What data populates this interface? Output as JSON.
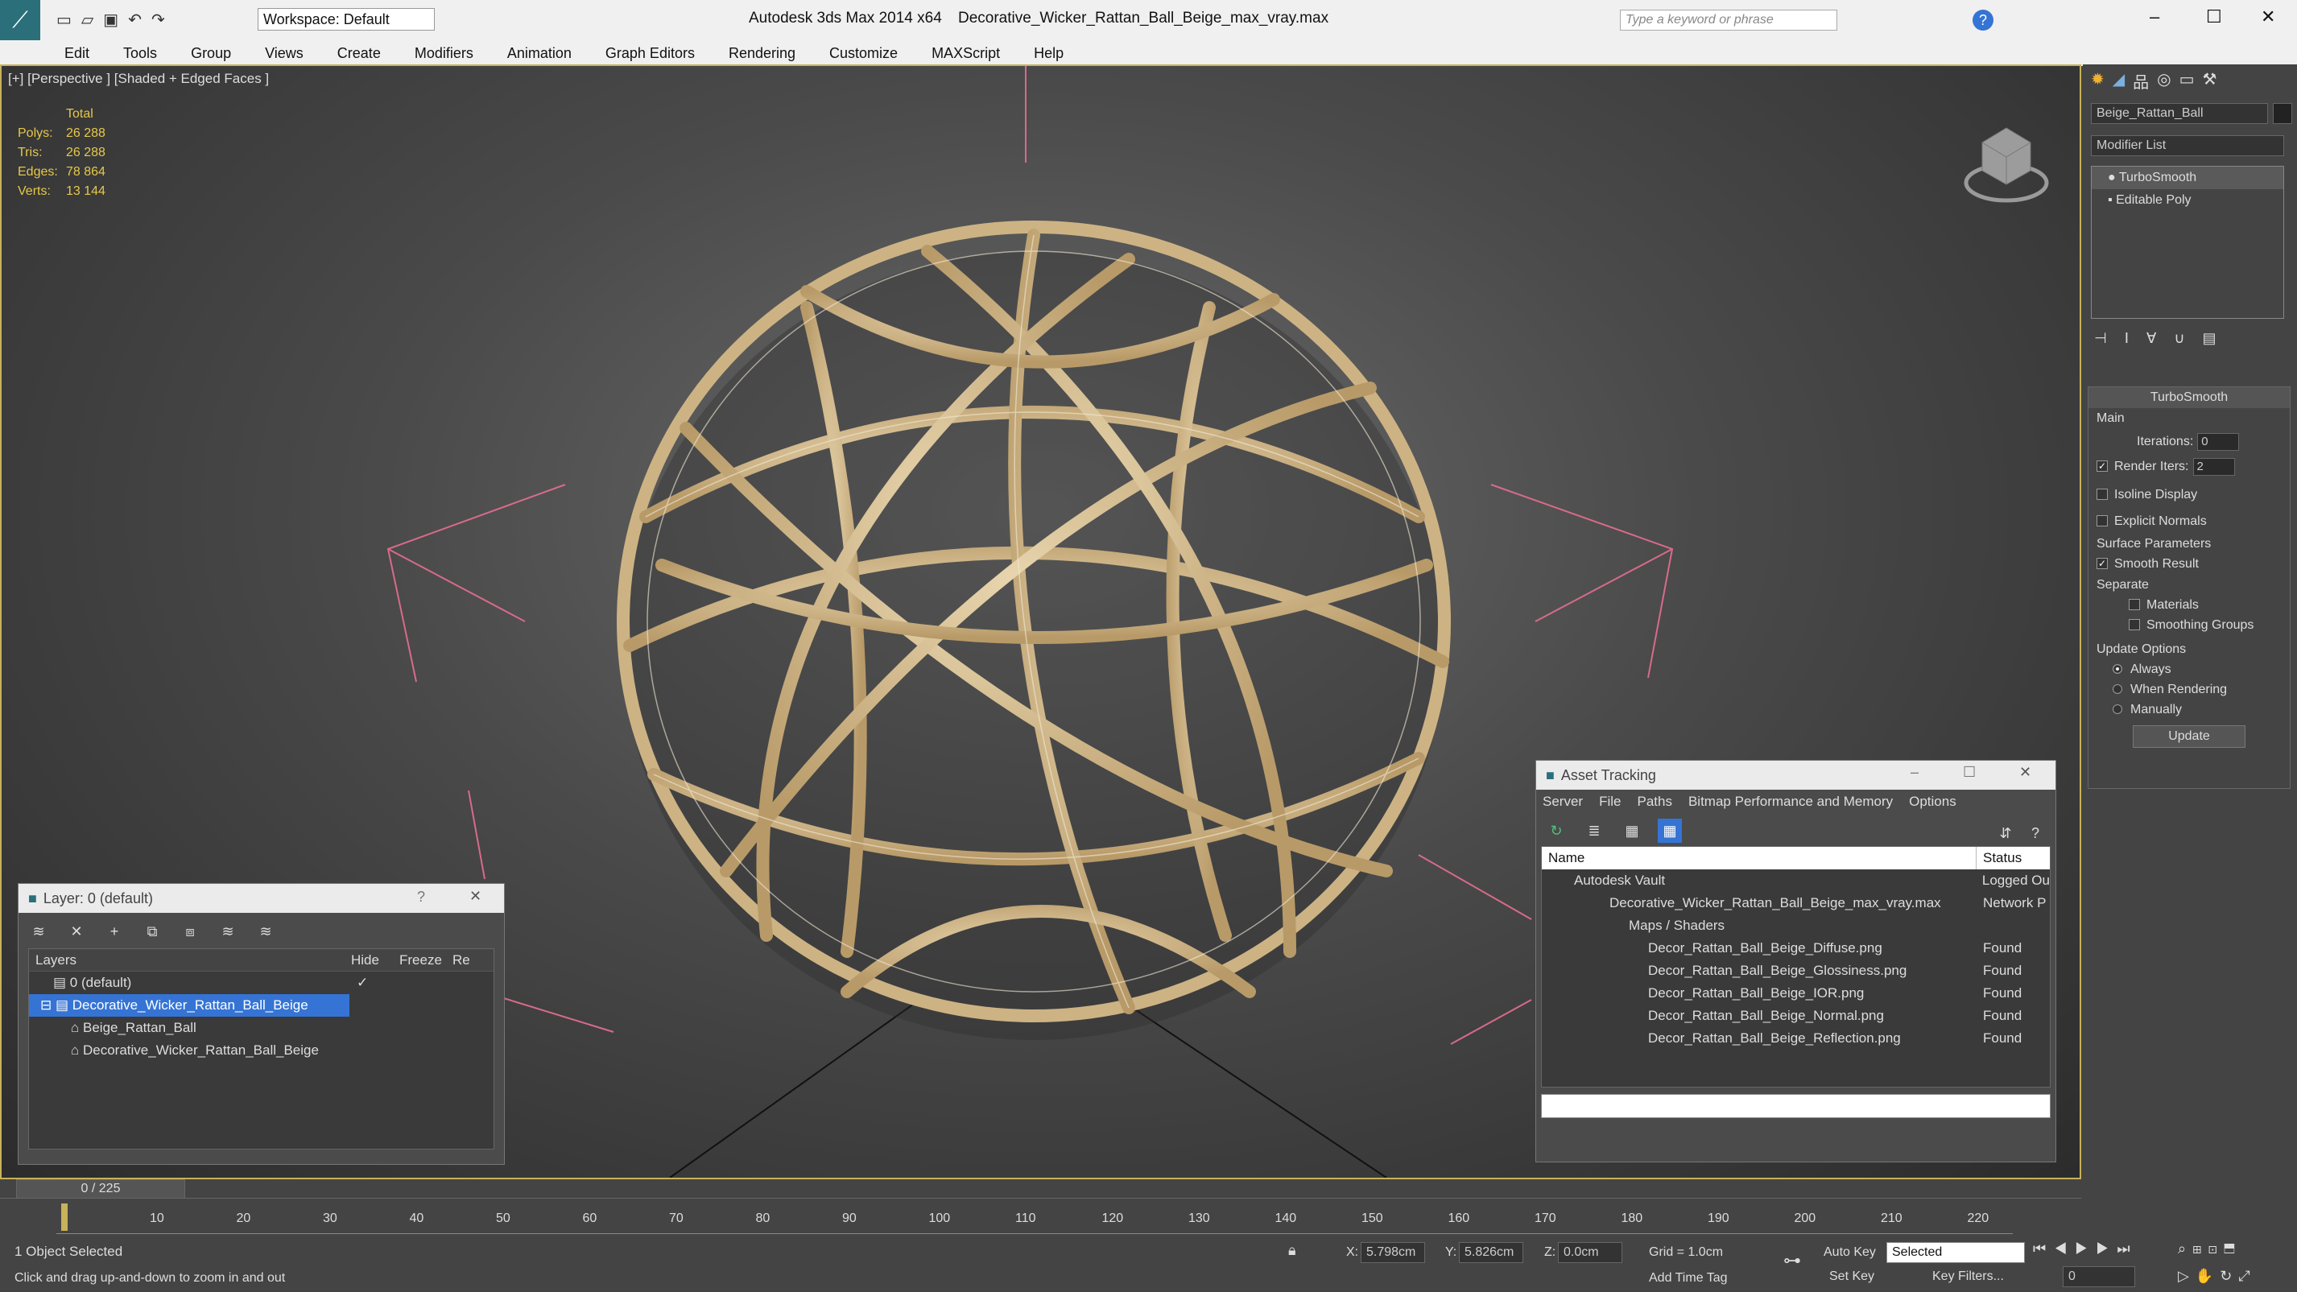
{
  "titlebar": {
    "workspace": "Workspace: Default",
    "app": "Autodesk 3ds Max  2014 x64",
    "file": "Decorative_Wicker_Rattan_Ball_Beige_max_vray.max",
    "search_placeholder": "Type a keyword or phrase"
  },
  "menu": [
    "Edit",
    "Tools",
    "Group",
    "Views",
    "Create",
    "Modifiers",
    "Animation",
    "Graph Editors",
    "Rendering",
    "Customize",
    "MAXScript",
    "Help"
  ],
  "viewport": {
    "label": "[+] [Perspective ] [Shaded + Edged Faces ]",
    "stats": {
      "header": "Total",
      "rows": [
        {
          "k": "Polys:",
          "v": "26 288"
        },
        {
          "k": "Tris:",
          "v": "26 288"
        },
        {
          "k": "Edges:",
          "v": "78 864"
        },
        {
          "k": "Verts:",
          "v": "13 144"
        }
      ]
    }
  },
  "layer_window": {
    "title": "Layer: 0 (default)",
    "help": "?",
    "cols": [
      "Layers",
      "Hide",
      "Freeze",
      "Re"
    ],
    "rows": [
      "0 (default)",
      "Decorative_Wicker_Rattan_Ball_Beige",
      "Beige_Rattan_Ball",
      "Decorative_Wicker_Rattan_Ball_Beige"
    ]
  },
  "asset_window": {
    "title": "Asset Tracking",
    "menu": [
      "Server",
      "File",
      "Paths",
      "Bitmap Performance and Memory",
      "Options"
    ],
    "cols": [
      "Name",
      "Status"
    ],
    "rows": [
      {
        "name": "Autodesk Vault",
        "status": "Logged Ou"
      },
      {
        "name": "Decorative_Wicker_Rattan_Ball_Beige_max_vray.max",
        "status": "Network P"
      },
      {
        "name": "Maps / Shaders",
        "status": ""
      },
      {
        "name": "Decor_Rattan_Ball_Beige_Diffuse.png",
        "status": "Found"
      },
      {
        "name": "Decor_Rattan_Ball_Beige_Glossiness.png",
        "status": "Found"
      },
      {
        "name": "Decor_Rattan_Ball_Beige_IOR.png",
        "status": "Found"
      },
      {
        "name": "Decor_Rattan_Ball_Beige_Normal.png",
        "status": "Found"
      },
      {
        "name": "Decor_Rattan_Ball_Beige_Reflection.png",
        "status": "Found"
      }
    ]
  },
  "cmd": {
    "object_name": "Beige_Rattan_Ball",
    "modifier_list": "Modifier List",
    "stack": [
      "TurboSmooth",
      "Editable Poly"
    ],
    "rollout": "TurboSmooth",
    "main": "Main",
    "iterations_label": "Iterations:",
    "iterations": "0",
    "render_iters_label": "Render Iters:",
    "render_iters": "2",
    "isoline": "Isoline Display",
    "explicit": "Explicit Normals",
    "surface": "Surface Parameters",
    "smooth": "Smooth Result",
    "separate": "Separate",
    "materials": "Materials",
    "smoothing": "Smoothing Groups",
    "update_opts": "Update Options",
    "always": "Always",
    "when_rendering": "When Rendering",
    "manually": "Manually",
    "update": "Update"
  },
  "timeline": {
    "frame": "0 / 225",
    "ticks": [
      "10",
      "20",
      "30",
      "40",
      "50",
      "60",
      "70",
      "80",
      "90",
      "100",
      "110",
      "120",
      "130",
      "140",
      "150",
      "160",
      "170",
      "180",
      "190",
      "200",
      "210",
      "220"
    ]
  },
  "status": {
    "selected": "1 Object Selected",
    "prompt": "Click and drag up-and-down to zoom in and out",
    "x_label": "X:",
    "x": "5.798cm",
    "y_label": "Y:",
    "y": "5.826cm",
    "z_label": "Z:",
    "z": "0.0cm",
    "grid": "Grid = 1.0cm",
    "auto_key": "Auto Key",
    "selected_dd": "Selected",
    "set_key": "Set Key",
    "key_filters": "Key Filters...",
    "add_time_tag": "Add Time Tag",
    "frame_field": "0"
  },
  "colors": {
    "accent": "#3574d4",
    "viewport_border": "#c8b25a",
    "rattan": "#d9c39a",
    "stats": "#e6c84a",
    "bracket": "#d86b8a"
  }
}
